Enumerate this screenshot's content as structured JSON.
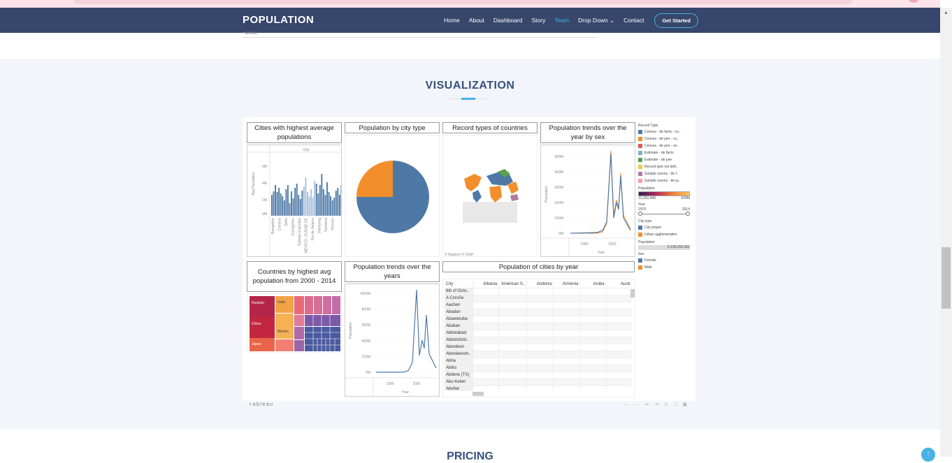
{
  "navbar": {
    "brand": "POPULATION",
    "links": [
      "Home",
      "About",
      "Dashboard",
      "Story",
      "Team",
      "Drop Down",
      "Contact"
    ],
    "active": "Team",
    "cta": "Get Started"
  },
  "prev_toolbar_label": "+ableau",
  "section": {
    "title": "VISUALIZATION"
  },
  "next_section_title": "PRICING",
  "dashboard": {
    "panels": {
      "p1": "Cities with highest average populations",
      "p2": "Population by city type",
      "p3": "Record types of countries",
      "p4": "Population trends over the year by sex",
      "p5": "Countries by highest avg population from 2000 - 2014",
      "p6": "Population trends over the years",
      "p7": "Population of cities by year"
    },
    "bar_header": "City",
    "bar_ylabel": "Avg Population",
    "bar_cities": [
      "Bangalore",
      "Chennai",
      "Delhi",
      "Guangzhou",
      "Kolkata (Calcutta)",
      "MEXICO, CIUDAD DE",
      "Rio de Janeiro",
      "Shenyang",
      "Tashkent",
      "Yerevan"
    ],
    "map_credit": "© Mapbox © OSM",
    "trend_ylabel": "Population",
    "trend_xlabel": "Year",
    "treemap_labels": [
      "Russian",
      "India",
      "China",
      "Mexico",
      "Japan"
    ],
    "table_header_city": "City",
    "table_countries": [
      "Albania",
      "American S..",
      "Andorra",
      "Armenia",
      "Aruba",
      "Austr"
    ],
    "table_cities": [
      "6th of Octo..",
      "A Coruña",
      "Aachen",
      "Abadan",
      "Abaetetuba",
      "Abakan",
      "Abbotabad",
      "Abbotsford..",
      "Aberdeen",
      "Aberdeensh..",
      "Abha",
      "Abiko",
      "Abilene (TX)",
      "Abo Keber",
      "Abohar"
    ],
    "legend": {
      "record_title": "Record Type",
      "record_types": [
        {
          "label": "Census - de facto - co..",
          "color": "#4e79a7"
        },
        {
          "label": "Census - de jure - co..",
          "color": "#f28e2b"
        },
        {
          "label": "Census - de jure - se..",
          "color": "#e15759"
        },
        {
          "label": "Estimate - de facto",
          "color": "#76b7b2"
        },
        {
          "label": "Estimate - de jure",
          "color": "#59a14f"
        },
        {
          "label": "Record type not defi..",
          "color": "#edc948"
        },
        {
          "label": "Sample survey - de f..",
          "color": "#b07aa1"
        },
        {
          "label": "Sample survey - de ju..",
          "color": "#ff9da7"
        }
      ],
      "population_title": "Population",
      "population_min": "13,322,446",
      "population_max": "628M",
      "year_title": "Year",
      "year_min": "1970",
      "year_max": "2014",
      "citytype_title": "City type",
      "city_types": [
        {
          "label": "City proper",
          "color": "#4e79a7"
        },
        {
          "label": "Urban agglomeration",
          "color": "#f28e2b"
        }
      ],
      "population2_title": "Population",
      "population2_value": "6,199,252,461",
      "sex_title": "Sex",
      "sexes": [
        {
          "label": "Female",
          "color": "#4e79a7"
        },
        {
          "label": "Male",
          "color": "#f28e2b"
        }
      ]
    }
  },
  "viz_toolbar_logo": "+ableau",
  "chart_data": [
    {
      "type": "bar",
      "title": "Cities with highest average populations",
      "xlabel": "City",
      "ylabel": "Avg Population",
      "ylim": [
        0,
        8000000
      ],
      "ticks": [
        "0M",
        "2M",
        "4M",
        "6M"
      ]
    },
    {
      "type": "pie",
      "title": "Population by city type",
      "series": [
        {
          "name": "City proper",
          "values": [
            75
          ]
        },
        {
          "name": "Urban agglomeration",
          "values": [
            25
          ]
        }
      ]
    },
    {
      "type": "line",
      "title": "Population trends over the year by sex",
      "ylabel": "Population",
      "xlabel": "Year",
      "ticks_y": [
        "0M",
        "100M",
        "200M",
        "300M",
        "400M",
        "500M"
      ],
      "ticks_x": [
        "1980",
        "2000"
      ]
    },
    {
      "type": "line",
      "title": "Population trends over the years",
      "ylabel": "Population",
      "xlabel": "Year",
      "ticks_y": [
        "0M",
        "200M",
        "400M",
        "600M",
        "800M",
        "1000M"
      ],
      "ticks_x": [
        "1980",
        "2000"
      ]
    }
  ]
}
